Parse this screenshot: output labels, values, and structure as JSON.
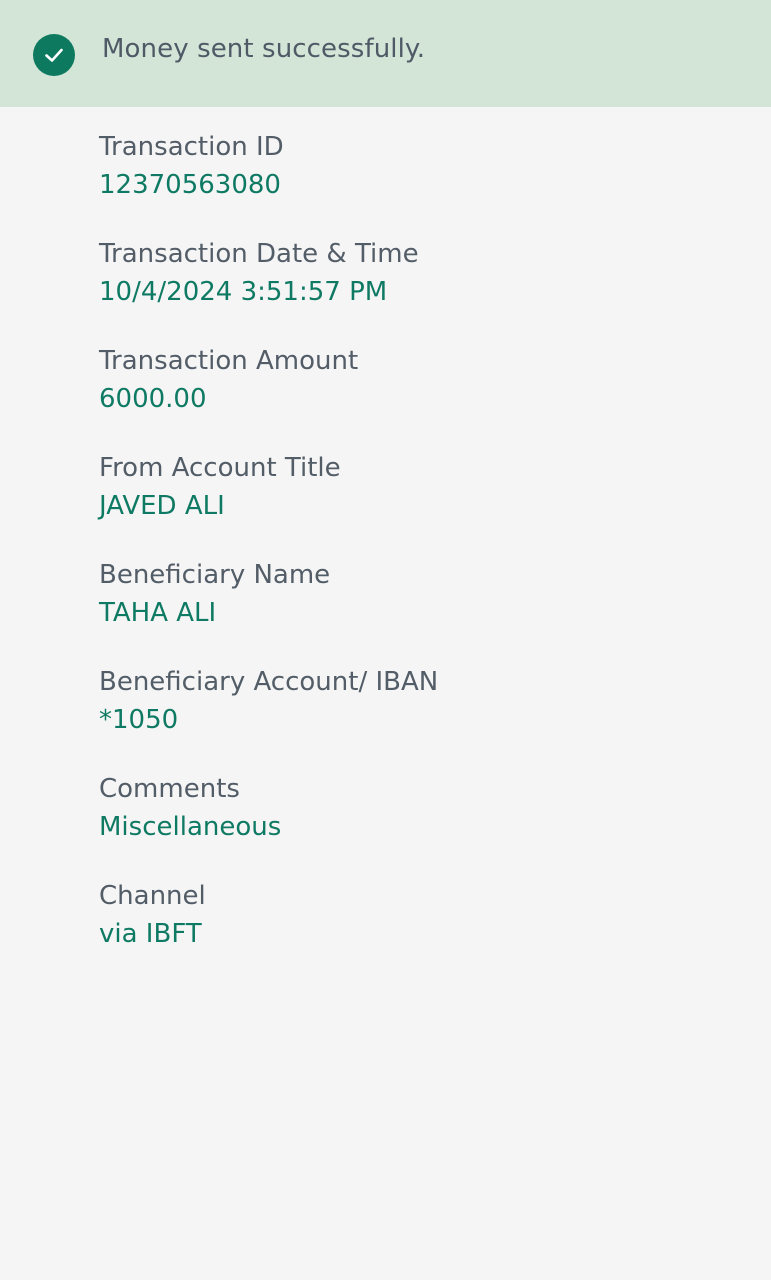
{
  "banner": {
    "icon": "check-circle-icon",
    "message": "Money sent successfully."
  },
  "colors": {
    "banner_bg": "#d2e5d7",
    "accent_green": "#0d7a5f",
    "label_gray": "#535d68",
    "page_bg": "#f5f5f5"
  },
  "details": [
    {
      "label": "Transaction ID",
      "value": "12370563080"
    },
    {
      "label": "Transaction Date & Time",
      "value": "10/4/2024 3:51:57 PM"
    },
    {
      "label": "Transaction Amount",
      "value": "6000.00"
    },
    {
      "label": "From Account Title",
      "value": "JAVED ALI"
    },
    {
      "label": "Beneficiary Name",
      "value": "TAHA ALI"
    },
    {
      "label": "Beneficiary Account/ IBAN",
      "value": "*1050"
    },
    {
      "label": "Comments",
      "value": "Miscellaneous"
    },
    {
      "label": "Channel",
      "value": "via IBFT"
    }
  ]
}
